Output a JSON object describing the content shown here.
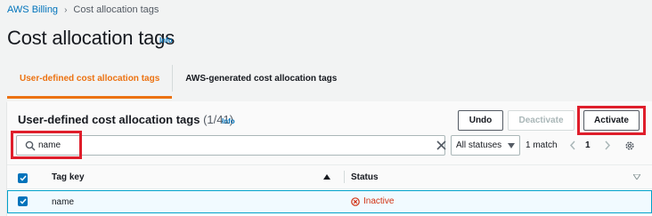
{
  "breadcrumb": {
    "root": "AWS Billing",
    "current": "Cost allocation tags"
  },
  "page": {
    "title": "Cost allocation tags",
    "info": "Info"
  },
  "tabs": [
    {
      "label": "User-defined cost allocation tags",
      "active": true
    },
    {
      "label": "AWS-generated cost allocation tags",
      "active": false
    }
  ],
  "panel": {
    "title": "User-defined cost allocation tags",
    "count": "(1/41)",
    "info": "Info",
    "buttons": {
      "undo": "Undo",
      "deactivate": "Deactivate",
      "activate": "Activate"
    }
  },
  "filter": {
    "search_value": "name",
    "status_select": "All statuses",
    "match_text": "1 match",
    "page_number": "1"
  },
  "table": {
    "columns": [
      "Tag key",
      "Status"
    ],
    "rows": [
      {
        "tag_key": "name",
        "status": "Inactive",
        "selected": true
      }
    ]
  },
  "colors": {
    "accent_orange": "#ec7211",
    "link_blue": "#0073bb",
    "highlight_red": "#df1e2b",
    "inactive_red": "#d13212"
  }
}
